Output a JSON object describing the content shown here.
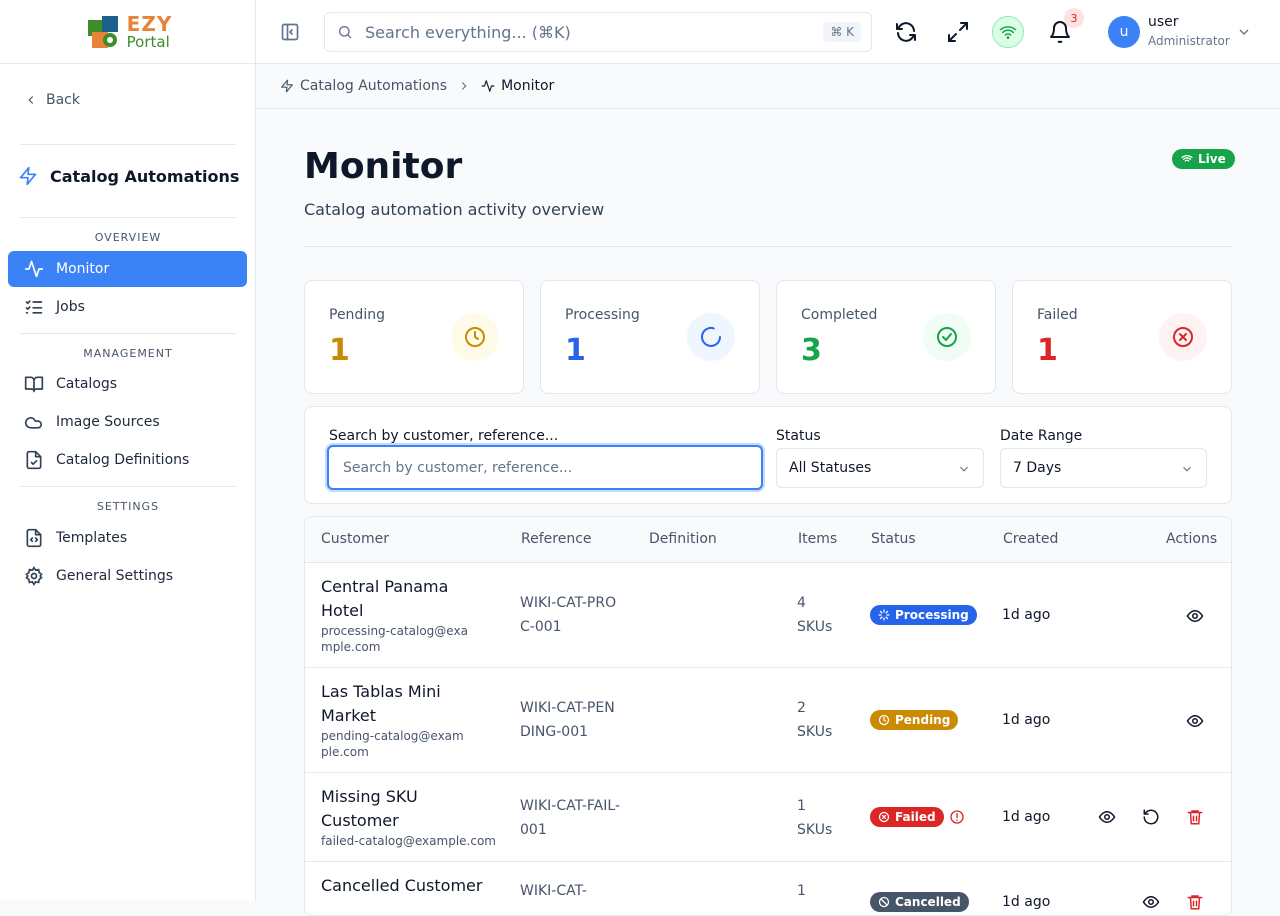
{
  "app": {
    "logo_top": "EZY",
    "logo_bottom": "Portal"
  },
  "sidebar": {
    "back_label": "Back",
    "module_title": "Catalog Automations",
    "sections": [
      {
        "title": "OVERVIEW",
        "items": [
          {
            "label": "Monitor",
            "icon": "activity-icon",
            "active": true
          },
          {
            "label": "Jobs",
            "icon": "list-checks-icon"
          }
        ]
      },
      {
        "title": "MANAGEMENT",
        "items": [
          {
            "label": "Catalogs",
            "icon": "book-icon"
          },
          {
            "label": "Image Sources",
            "icon": "cloud-icon"
          },
          {
            "label": "Catalog Definitions",
            "icon": "file-check-icon"
          }
        ]
      },
      {
        "title": "SETTINGS",
        "items": [
          {
            "label": "Templates",
            "icon": "file-code-icon"
          },
          {
            "label": "General Settings",
            "icon": "gear-icon"
          }
        ]
      }
    ]
  },
  "topbar": {
    "search_placeholder": "Search everything... (⌘K)",
    "shortcut": "⌘ K",
    "notification_count": "3",
    "user": {
      "initial": "u",
      "name": "user",
      "role": "Administrator"
    }
  },
  "breadcrumb": {
    "parent": "Catalog Automations",
    "current": "Monitor"
  },
  "page": {
    "title": "Monitor",
    "subtitle": "Catalog automation activity overview",
    "live_label": "Live"
  },
  "stats": [
    {
      "label": "Pending",
      "value": "1",
      "color": "#ca8a04"
    },
    {
      "label": "Processing",
      "value": "1",
      "color": "#2563eb"
    },
    {
      "label": "Completed",
      "value": "3",
      "color": "#16a34a"
    },
    {
      "label": "Failed",
      "value": "1",
      "color": "#dc2626"
    }
  ],
  "filters": {
    "search_label": "Search by customer, reference...",
    "search_placeholder": "Search by customer, reference...",
    "status_label": "Status",
    "status_value": "All Statuses",
    "date_label": "Date Range",
    "date_value": "7 Days"
  },
  "table": {
    "columns": [
      "Customer",
      "Reference",
      "Definition",
      "Items",
      "Status",
      "Created",
      "Actions"
    ],
    "rows": [
      {
        "customer": "Central Panama Hotel",
        "email": "processing-catalog@example.com",
        "reference": "WIKI-CAT-PROC-001",
        "items": "4 SKUs",
        "status": "Processing",
        "created": "1d ago"
      },
      {
        "customer": "Las Tablas Mini Market",
        "email": "pending-catalog@example.com",
        "reference": "WIKI-CAT-PENDING-001",
        "items": "2 SKUs",
        "status": "Pending",
        "created": "1d ago"
      },
      {
        "customer": "Missing SKU Customer",
        "email": "failed-catalog@example.com",
        "reference": "WIKI-CAT-FAIL-001",
        "items": "1 SKUs",
        "status": "Failed",
        "created": "1d ago"
      },
      {
        "customer": "Cancelled Customer",
        "email": "",
        "reference": "WIKI-CAT-",
        "items": "1",
        "status": "Cancelled",
        "created": "1d ago"
      }
    ]
  },
  "colors": {
    "accent": "#3b82f6",
    "processing": "#2563eb",
    "pending": "#ca8a04",
    "failed": "#dc2626",
    "cancelled": "#475569",
    "live": "#16a34a"
  }
}
